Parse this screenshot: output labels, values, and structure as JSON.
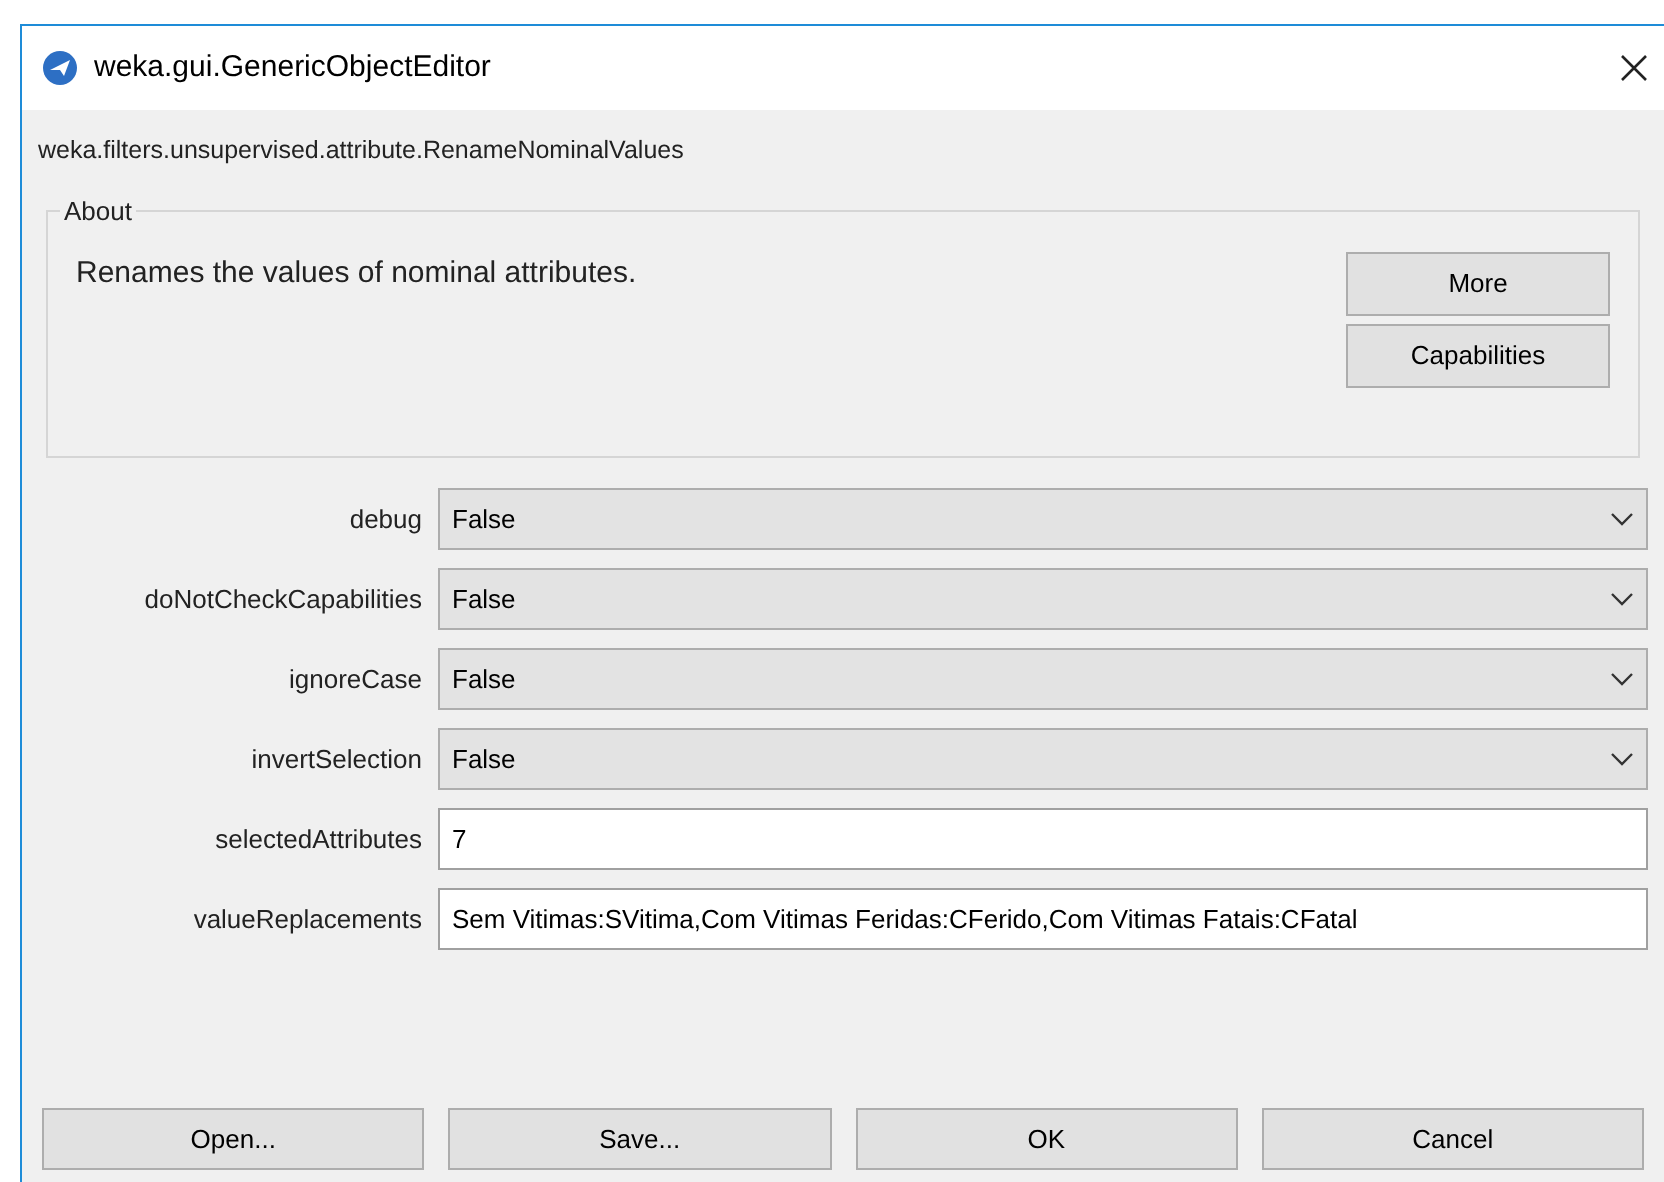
{
  "window": {
    "title": "weka.gui.GenericObjectEditor"
  },
  "class_name": "weka.filters.unsupervised.attribute.RenameNominalValues",
  "about": {
    "title": "About",
    "description": "Renames the values of nominal attributes.",
    "buttons": [
      "More",
      "Capabilities"
    ]
  },
  "properties": [
    {
      "kind": "dropdown",
      "label": "debug",
      "value": "False"
    },
    {
      "kind": "dropdown",
      "label": "doNotCheckCapabilities",
      "value": "False"
    },
    {
      "kind": "dropdown",
      "label": "ignoreCase",
      "value": "False"
    },
    {
      "kind": "dropdown",
      "label": "invertSelection",
      "value": "False"
    },
    {
      "kind": "text",
      "label": "selectedAttributes",
      "value": "7"
    },
    {
      "kind": "text",
      "label": "valueReplacements",
      "value": "Sem Vitimas:SVitima,Com Vitimas Feridas:CFerido,Com Vitimas Fatais:CFatal"
    }
  ],
  "buttons": [
    "Open...",
    "Save...",
    "OK",
    "Cancel"
  ]
}
